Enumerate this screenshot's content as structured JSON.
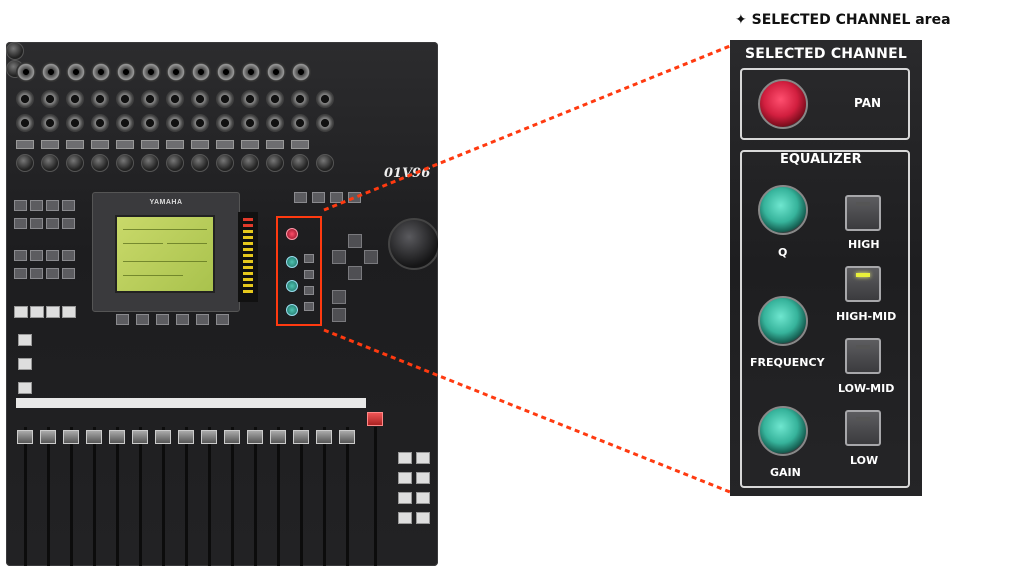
{
  "callout": {
    "title": "✦ SELECTED CHANNEL area"
  },
  "panel": {
    "title": "SELECTED CHANNEL",
    "pan_label": "PAN",
    "equalizer_title": "EQUALIZER",
    "knobs": [
      {
        "label": "Q"
      },
      {
        "label": "FREQUENCY"
      },
      {
        "label": "GAIN"
      }
    ],
    "band_buttons": [
      {
        "label": "HIGH",
        "lit": false
      },
      {
        "label": "HIGH-MID",
        "lit": true
      },
      {
        "label": "LOW-MID",
        "lit": false
      },
      {
        "label": "LOW",
        "lit": false
      }
    ]
  },
  "mixer": {
    "brand": "YAMAHA",
    "model": "01V96",
    "channels": 12
  },
  "colors": {
    "callout_frame": "#ff3a10",
    "pan_knob": "#d21f3f",
    "eq_knobs": "#36b39b",
    "selected_led": "#e8f03a"
  }
}
